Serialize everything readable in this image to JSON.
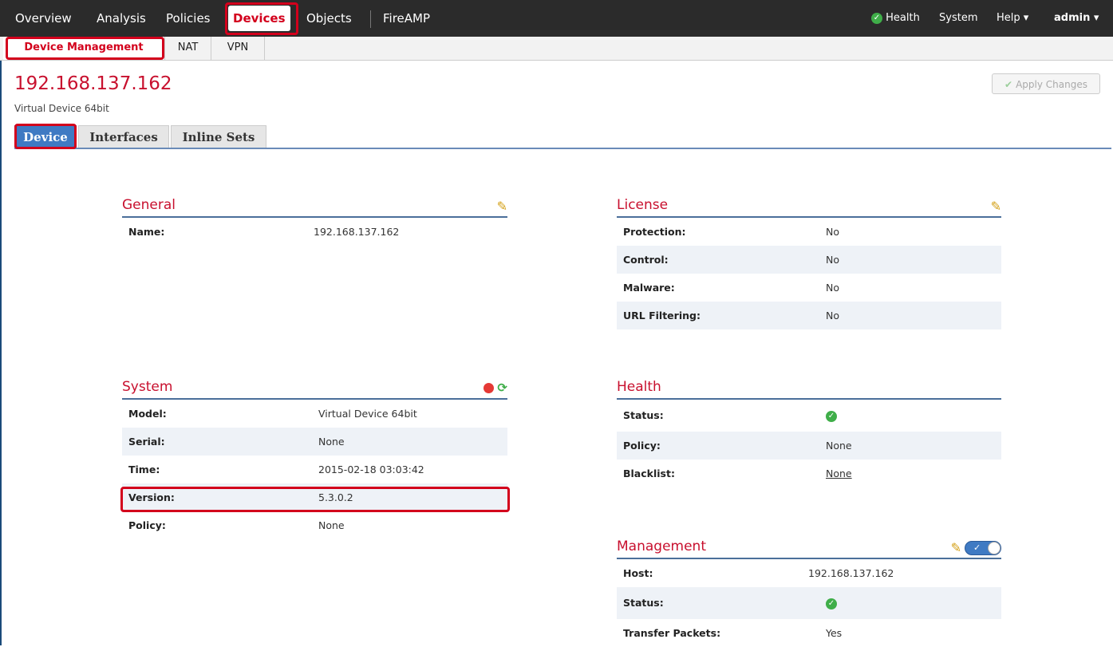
{
  "topnav": {
    "items": [
      "Overview",
      "Analysis",
      "Policies",
      "Devices",
      "Objects",
      "FireAMP"
    ],
    "right": {
      "health": "Health",
      "system": "System",
      "help": "Help ▾",
      "user": "admin ▾"
    }
  },
  "subnav": {
    "tabs": [
      "Device Management",
      "NAT",
      "VPN"
    ]
  },
  "page": {
    "title": "192.168.137.162",
    "subtitle": "Virtual Device 64bit",
    "apply_label": "Apply Changes"
  },
  "tabs": [
    "Device",
    "Interfaces",
    "Inline Sets"
  ],
  "general": {
    "title": "General",
    "rows": [
      {
        "label": "Name:",
        "value": "192.168.137.162"
      }
    ]
  },
  "system": {
    "title": "System",
    "rows": [
      {
        "label": "Model:",
        "value": "Virtual Device 64bit"
      },
      {
        "label": "Serial:",
        "value": "None"
      },
      {
        "label": "Time:",
        "value": "2015-02-18 03:03:42"
      },
      {
        "label": "Version:",
        "value": "5.3.0.2"
      },
      {
        "label": "Policy:",
        "value": "None"
      }
    ]
  },
  "license": {
    "title": "License",
    "rows": [
      {
        "label": "Protection:",
        "value": "No"
      },
      {
        "label": "Control:",
        "value": "No"
      },
      {
        "label": "Malware:",
        "value": "No"
      },
      {
        "label": "URL Filtering:",
        "value": "No"
      }
    ]
  },
  "health": {
    "title": "Health",
    "rows": [
      {
        "label": "Status:",
        "value": ""
      },
      {
        "label": "Policy:",
        "value": "None"
      },
      {
        "label": "Blacklist:",
        "value": "None"
      }
    ]
  },
  "management": {
    "title": "Management",
    "rows": [
      {
        "label": "Host:",
        "value": "192.168.137.162"
      },
      {
        "label": "Status:",
        "value": ""
      },
      {
        "label": "Transfer Packets:",
        "value": "Yes"
      }
    ]
  },
  "colors": {
    "accent_red": "#c8102e",
    "nav_bg": "#2b2b2b",
    "tab_active": "#3f7ac3",
    "status_ok": "#3fae49"
  }
}
